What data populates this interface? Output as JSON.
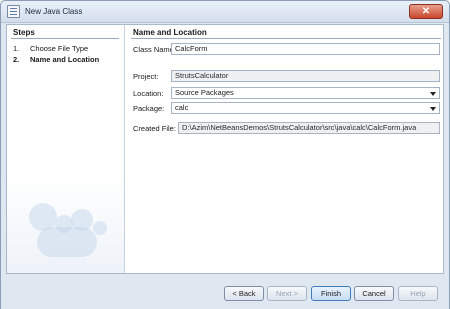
{
  "window": {
    "title": "New Java Class",
    "close_glyph": "✕"
  },
  "steps": {
    "heading": "Steps",
    "items": [
      {
        "num": "1.",
        "label": "Choose File Type"
      },
      {
        "num": "2.",
        "label": "Name and Location"
      }
    ]
  },
  "form": {
    "heading": "Name and Location",
    "class_name": {
      "label": "Class Name:",
      "value": "CalcForm"
    },
    "project": {
      "label": "Project:",
      "value": "StrutsCalculator"
    },
    "location": {
      "label": "Location:",
      "value": "Source Packages"
    },
    "package": {
      "label": "Package:",
      "value": "calc"
    },
    "created_file": {
      "label": "Created File:",
      "value": "D:\\Azim\\NetBeansDemos\\StrutsCalculator\\src\\java\\calc\\CalcForm.java"
    }
  },
  "buttons": {
    "back": "< Back",
    "next": "Next >",
    "finish": "Finish",
    "cancel": "Cancel",
    "help": "Help"
  }
}
